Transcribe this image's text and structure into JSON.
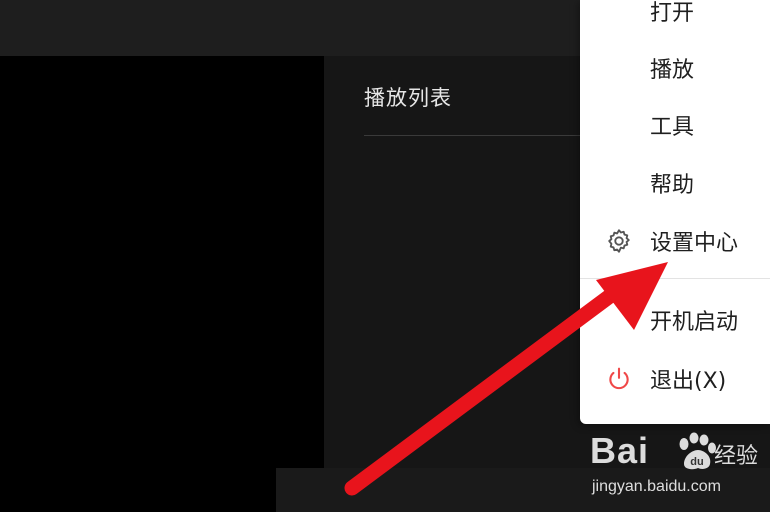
{
  "playlist": {
    "title": "播放列表"
  },
  "menu": {
    "items": [
      {
        "label": "打开",
        "icon": null
      },
      {
        "label": "播放",
        "icon": null
      },
      {
        "label": "工具",
        "icon": null
      },
      {
        "label": "帮助",
        "icon": null
      },
      {
        "label": "设置中心",
        "icon": "gear-icon"
      },
      {
        "label": "开机启动",
        "icon": null
      },
      {
        "label": "退出(X)",
        "icon": "power-icon"
      }
    ],
    "power_icon_color": "#f04848"
  },
  "annotation": {
    "arrow_color": "#e8141c"
  },
  "watermark": {
    "brand": "Bai",
    "brand_suffix": "du",
    "product": "经验",
    "url": "jingyan.baidu.com"
  }
}
